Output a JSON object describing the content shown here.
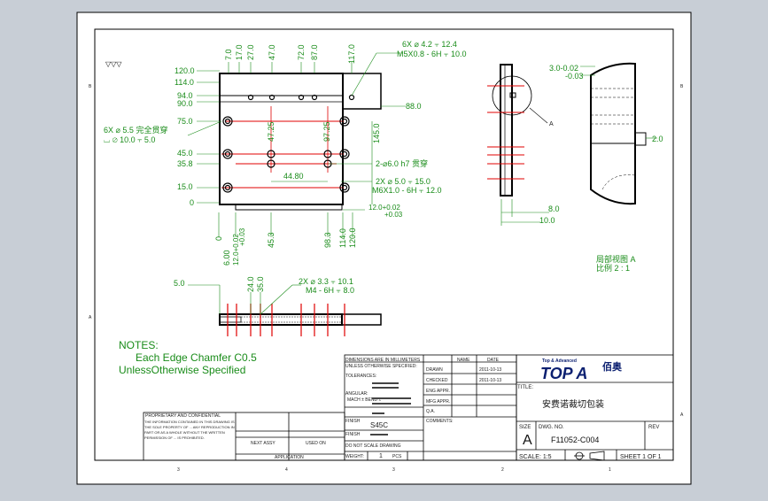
{
  "drawing": {
    "roughness_symbol": "▽▽▽",
    "left_dims": [
      "120.0",
      "114.0",
      "94.0",
      "90.0",
      "75.0",
      "45.0",
      "35.8",
      "15.0",
      "0"
    ],
    "top_dims": [
      "7.0",
      "17.0",
      "27.0",
      "47.0",
      "72.0",
      "87.0",
      "117.0"
    ],
    "bottom_dims": [
      "0",
      "6.00",
      "12.0+0.02\n+0.03",
      "45.3",
      "98.3",
      "114.0",
      "120.0"
    ],
    "rotated_dims": [
      "47.25",
      "97.25"
    ],
    "callout_holes_1": "6X ⌀ 4.2 ⫟ 12.4",
    "callout_holes_2": "M5X0.8 - 6H ⫟ 10.0",
    "callout_right_88": "88.0",
    "callout_right_145": "145.0",
    "callout_left_1": "6X ⌀ 5.5 完全贯穿",
    "callout_left_2": "⌴ ⌀ 10.0 ⫟ 5.0",
    "callout_pin": "2-⌀6.0 h7 贯穿",
    "callout_mid_1": "2X ⌀ 5.0 ⫟ 15.0",
    "callout_mid_2": "M6X1.0 - 6H ⫟ 12.0",
    "dim_4480": "44.80",
    "dim_12_tol_1": "12.0+0.02",
    "dim_12_tol_2": "+0.03",
    "side_dim_30_1": "3.0-0.02",
    "side_dim_30_2": "-0.03",
    "side_dim_20": "2.0",
    "side_dim_80": "8.0",
    "side_dim_100": "10.0",
    "detail_label": "A",
    "detail_title": "局部视图 A",
    "detail_scale": "比例 2 : 1",
    "bottom_view_50": "5.0",
    "bottom_view_240": "24.0",
    "bottom_view_350": "35.0",
    "bottom_callout_1": "2X ⌀ 3.3 ⫟ 10.1",
    "bottom_callout_2": "M4 - 6H ⫟ 8.0",
    "notes_title": "NOTES:",
    "notes_line_1": "Each Edge Chamfer C0.5",
    "notes_line_2": "UnlessOtherwise Specified"
  },
  "title_block": {
    "company_logo_text": "TOP A",
    "company_logo_tag": "Top & Advanced",
    "company_cn": "佰奥",
    "title_label": "TITLE:",
    "title_value": "安费诺裁切包装",
    "size_label": "SIZE",
    "size_value": "A",
    "dwg_label": "DWG. NO.",
    "dwg_value": "F11052-C004",
    "rev_label": "REV",
    "scale_label": "SCALE: 1:5",
    "sheet_label": "SHEET 1 OF 1",
    "material_value": "S45C",
    "drawn_label": "DRAWN",
    "checked_label": "CHECKED",
    "eng_label": "ENG APPR.",
    "mfg_label": "MFG APPR.",
    "qa_label": "Q.A.",
    "comments_label": "COMMENTS:",
    "name_label": "NAME",
    "date_label": "DATE",
    "date_1": "2011-10-13",
    "date_2": "2011-10-13",
    "next_assy": "NEXT ASSY",
    "used_on": "USED ON",
    "application": "APPLICATION",
    "finish_label": "FINISH",
    "tolerances": "TOLERANCES:",
    "dims_in_mm": "DIMENSIONS ARE IN MILLIMETERS",
    "unless_specified": "UNLESS OTHERWISE SPECIFIED:",
    "angular": "ANGULAR:",
    "mach_bend": "MACH ±  BEND ±",
    "proprietary_title": "PROPRIETARY AND CONFIDENTIAL",
    "proprietary_text": "THE INFORMATION CONTAINED IN THIS DRAWING IS THE SOLE PROPERTY OF ... ANY REPRODUCTION IN PART OR AS A WHOLE WITHOUT THE WRITTEN PERMISSION OF ... IS PROHIBITED.",
    "weight_label": "WEIGHT:",
    "do_not_scale": "DO NOT SCALE DRAWING",
    "qty": "1",
    "pcs": "PCS",
    "zone_3a": "3",
    "zone_4": "4",
    "zone_3b": "3",
    "zone_2": "2",
    "zone_1": "1",
    "row_a": "A",
    "row_b": "B"
  },
  "colors": {
    "green": "#1a8c1a",
    "red": "#e00000",
    "navy": "#0b1f70",
    "paper": "#ffffff",
    "background": "#c8ced6"
  }
}
